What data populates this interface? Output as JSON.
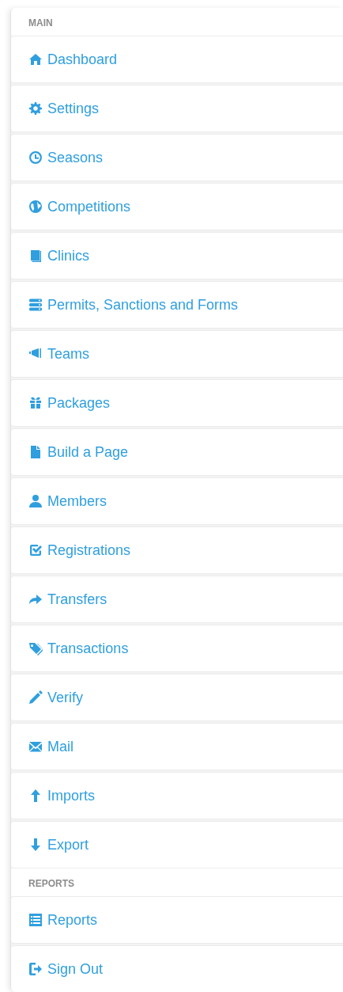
{
  "sections": [
    {
      "title": "MAIN",
      "items": [
        {
          "label": "Dashboard",
          "kind": "home"
        },
        {
          "label": "Settings",
          "kind": "gear"
        },
        {
          "label": "Seasons",
          "kind": "clock"
        },
        {
          "label": "Competitions",
          "kind": "globe"
        },
        {
          "label": "Clinics",
          "kind": "book"
        },
        {
          "label": "Permits, Sanctions and Forms",
          "kind": "server"
        },
        {
          "label": "Teams",
          "kind": "bullhorn"
        },
        {
          "label": "Packages",
          "kind": "gift"
        },
        {
          "label": "Build a Page",
          "kind": "file"
        },
        {
          "label": "Members",
          "kind": "user"
        },
        {
          "label": "Registrations",
          "kind": "check"
        },
        {
          "label": "Transfers",
          "kind": "share"
        },
        {
          "label": "Transactions",
          "kind": "tags"
        },
        {
          "label": "Verify",
          "kind": "pencil"
        },
        {
          "label": "Mail",
          "kind": "envelope"
        },
        {
          "label": "Imports",
          "kind": "up"
        },
        {
          "label": "Export",
          "kind": "down"
        }
      ]
    },
    {
      "title": "REPORTS",
      "items": [
        {
          "label": "Reports",
          "kind": "list"
        },
        {
          "label": "Sign Out",
          "kind": "signout"
        }
      ]
    }
  ]
}
